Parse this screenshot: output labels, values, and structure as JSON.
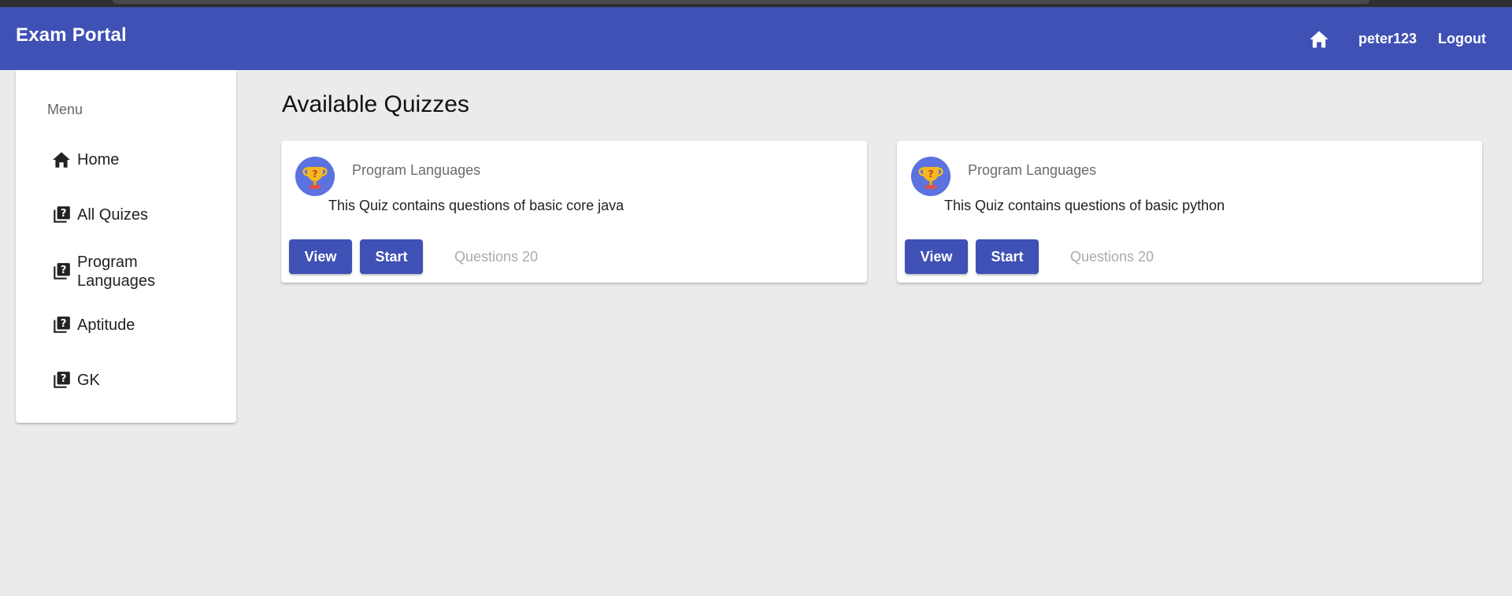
{
  "navbar": {
    "brand": "Exam Portal",
    "home_icon": "home-icon",
    "username": "peter123",
    "logout_label": "Logout",
    "color": "#3f51b5"
  },
  "sidebar": {
    "title": "Menu",
    "items": [
      {
        "label": "Home",
        "icon": "home-icon"
      },
      {
        "label": "All Quizes",
        "icon": "quiz-icon"
      },
      {
        "label": "Program Languages",
        "icon": "quiz-icon"
      },
      {
        "label": "Aptitude",
        "icon": "quiz-icon"
      },
      {
        "label": "GK",
        "icon": "quiz-icon"
      }
    ]
  },
  "main": {
    "title": "Available Quizzes",
    "quizzes": [
      {
        "category": "Program Languages",
        "description": "This Quiz contains questions of basic core java",
        "view_label": "View",
        "start_label": "Start",
        "questions_text": "Questions 20",
        "icon": "trophy-icon"
      },
      {
        "category": "Program Languages",
        "description": "This Quiz contains questions of basic python",
        "view_label": "View",
        "start_label": "Start",
        "questions_text": "Questions 20",
        "icon": "trophy-icon"
      }
    ]
  },
  "colors": {
    "primary": "#3f51b5",
    "background": "#ebebeb",
    "card": "#ffffff"
  }
}
